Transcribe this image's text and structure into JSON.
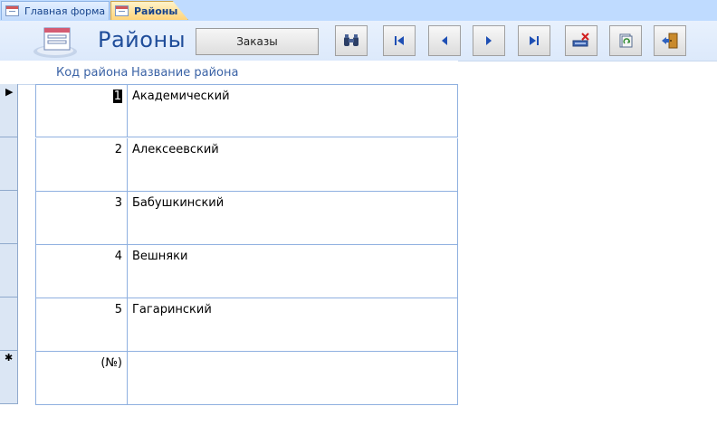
{
  "tabs": [
    {
      "label": "Главная форма",
      "active": false
    },
    {
      "label": "Районы",
      "active": true
    }
  ],
  "form": {
    "title": "Районы",
    "orders_button_label": "Заказы"
  },
  "toolbar": {
    "buttons": [
      {
        "name": "find-button",
        "icon": "binoculars-icon"
      },
      {
        "name": "first-record-button",
        "icon": "first-record-icon"
      },
      {
        "name": "previous-record-button",
        "icon": "previous-record-icon"
      },
      {
        "name": "next-record-button",
        "icon": "next-record-icon"
      },
      {
        "name": "last-record-button",
        "icon": "last-record-icon"
      },
      {
        "name": "delete-record-button",
        "icon": "delete-record-icon"
      },
      {
        "name": "refresh-button",
        "icon": "refresh-icon"
      },
      {
        "name": "close-form-button",
        "icon": "exit-door-icon"
      }
    ]
  },
  "grid": {
    "columns": [
      "Код района",
      "Название района"
    ],
    "rows": [
      {
        "code": "1",
        "name": "Академический"
      },
      {
        "code": "2",
        "name": "Алексеевский"
      },
      {
        "code": "3",
        "name": "Бабушкинский"
      },
      {
        "code": "4",
        "name": "Вешняки"
      },
      {
        "code": "5",
        "name": "Гагаринский"
      }
    ],
    "new_row_code": "(№)",
    "current_row_marker": "▶",
    "new_row_marker": "✱"
  },
  "colors": {
    "tab_strip": "#bfdbff",
    "active_tab": "#ffd47a",
    "header_background": "#dce9fb",
    "title_text": "#1f4d9a",
    "grid_lines": "#8fb0e0"
  }
}
